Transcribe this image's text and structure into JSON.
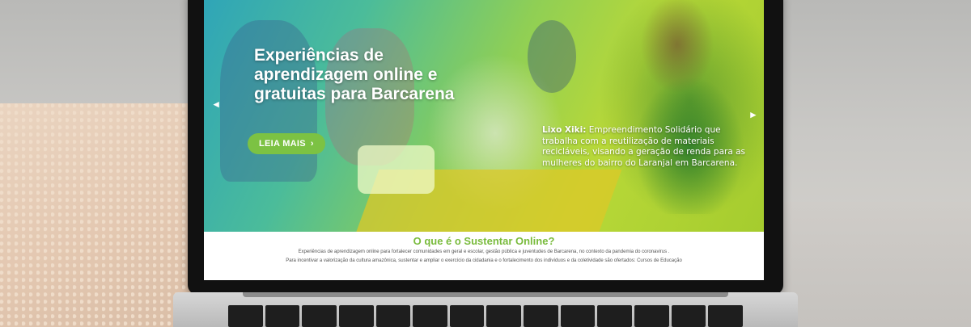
{
  "hero": {
    "title": "Experiências de aprendizagem online e gratuitas para Barcarena",
    "cta_label": "LEIA MAIS",
    "cta_icon": "chevron-right-icon",
    "prev_icon": "chevron-left-icon",
    "next_icon": "chevron-right-icon",
    "caption_lead": "Lixo Xiki:",
    "caption_text": "Empreendimento Solidário que trabalha com a reutilização de materiais recicláveis, visando a geração de renda para as mulheres do bairro do Laranjal em Barcarena."
  },
  "about": {
    "heading": "O que é o Sustentar Online?",
    "line1": "Experiências de aprendizagem online para fortalecer comunidades em geral e escolar, gestão pública e juventudes de Barcarena, no contexto da pandemia do coronavirus .",
    "line2": "Para incentivar a valorização da cultura amazônica, sustentar e ampliar o exercício da cidadania e o fortalecimento dos indivíduos e da coletividade são ofertados: Cursos de Educação"
  },
  "colors": {
    "accent": "#7cc243",
    "heading": "#79bb3c"
  }
}
